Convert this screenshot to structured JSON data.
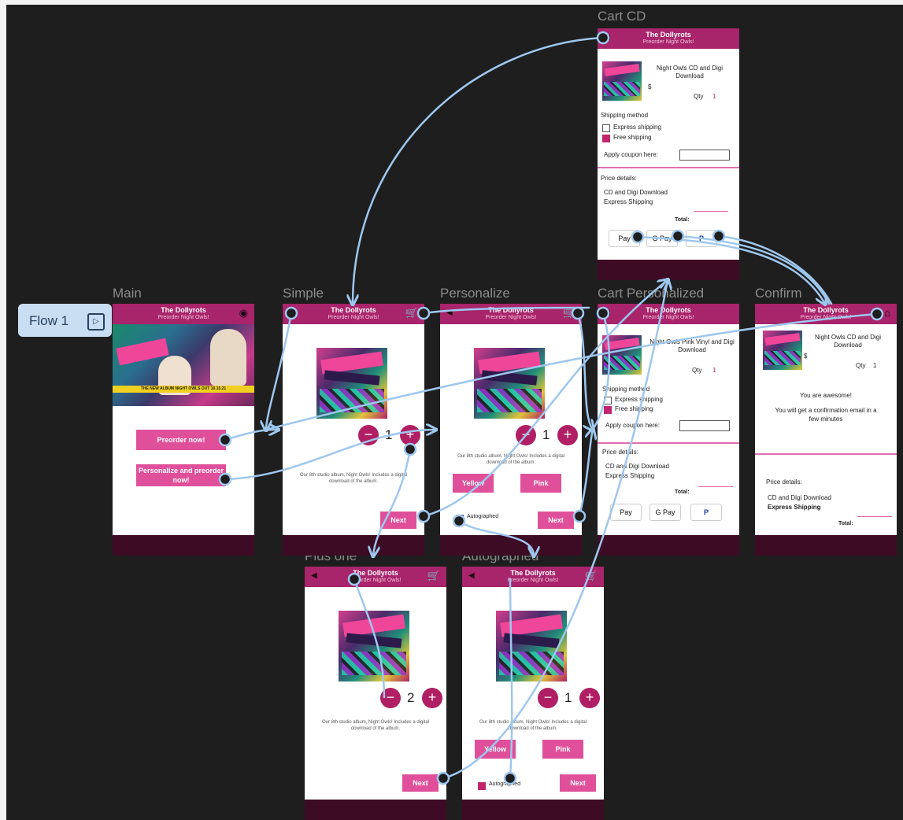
{
  "flow": {
    "label": "Flow 1",
    "icon": "play-flow-icon"
  },
  "header": {
    "title": "The Dollyrots",
    "subtitle": "Preorder Night Owls!"
  },
  "frames": {
    "main": {
      "label": "Main"
    },
    "simple": {
      "label": "Simple"
    },
    "personalize": {
      "label": "Personalize"
    },
    "cart_personalized": {
      "label": "Cart Personalized"
    },
    "confirm": {
      "label": "Confirm"
    },
    "cart_cd": {
      "label": "Cart CD"
    },
    "plus_one": {
      "label": "Plus one"
    },
    "autographed": {
      "label": "Autographed"
    }
  },
  "main": {
    "hero_band": "THE NEW ALBUM NIGHT OWLS OUT 10.15.21",
    "preorder_button": "Preorder now!",
    "personalize_button": "Personalize and preorder now!"
  },
  "product": {
    "description": "Our 8th studio album, Night Owls! Includes a digital download of the album.",
    "minus": "−",
    "plus": "+",
    "next": "Next",
    "yellow": "Yellow",
    "pink": "Pink",
    "autographed": "Autographed"
  },
  "simple": {
    "qty": "1"
  },
  "personalize": {
    "qty": "1"
  },
  "plus_one": {
    "qty": "2"
  },
  "autographed_screen": {
    "qty": "1"
  },
  "cart_cd": {
    "item_name": "Night Owls CD and Digi Download",
    "price": "$",
    "qty_label": "Qty",
    "qty_value": "1",
    "shipping_heading": "Shipping method",
    "express": "Express shipping",
    "free": "Free shipping",
    "coupon_label": "Apply coupon here:",
    "price_details": "Price details:",
    "line1": "CD and Digi Download",
    "line2": "Express Shipping",
    "total": "Total:",
    "apple_pay": "Pay",
    "google_pay": "G Pay",
    "paypal": "P"
  },
  "cart_personalized": {
    "item_name": "Night Owls Pink Vinyl and Digi Download",
    "qty_label": "Qty",
    "qty_value": "1",
    "shipping_heading": "Shipping method",
    "express": "Express shipping",
    "free": "Free shipping",
    "coupon_label": "Apply coupon here:",
    "price_details": "Price details:",
    "line1": "CD and Digi Download",
    "line2": "Express Shipping",
    "total": "Total:",
    "apple_pay": "Pay",
    "google_pay": "G Pay",
    "paypal": "P"
  },
  "confirm": {
    "item_name": "Night Owls CD and Digi Download",
    "price": "$",
    "qty_label": "Qty",
    "qty_value": "1",
    "awesome": "You are awesome!",
    "email_note": "You will get a confirmation email in a few minutes",
    "price_details": "Price details:",
    "line1": "CD and Digi Download",
    "line2": "Express Shipping",
    "total": "Total:"
  },
  "colors": {
    "canvas": "#1e1e1e",
    "header": "#a8246b",
    "footer": "#3d0b24",
    "button": "#e0509a",
    "stepper": "#b01f63",
    "wire": "#9ec7ee"
  }
}
